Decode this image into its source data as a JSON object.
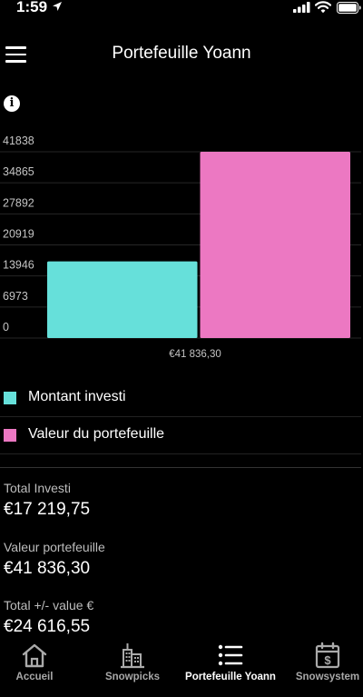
{
  "status_bar": {
    "time": "1:59"
  },
  "header": {
    "title": "Portefeuille Yoann"
  },
  "chart_data": {
    "type": "bar",
    "title": "",
    "xlabel": "",
    "ylabel": "",
    "categories": [
      "€41 836,30"
    ],
    "series": [
      {
        "name": "Montant investi",
        "values": [
          17219.75
        ],
        "color": "#66e0da"
      },
      {
        "name": "Valeur du portefeuille",
        "values": [
          41836.3
        ],
        "color": "#ec78c2"
      }
    ],
    "y_ticks": [
      "41838",
      "34865",
      "27892",
      "20919",
      "13946",
      "6973",
      "0"
    ],
    "ylim": [
      0,
      41838
    ],
    "grid": true,
    "legend": "bottom"
  },
  "legend": [
    {
      "label": "Montant investi",
      "color": "#66e0da"
    },
    {
      "label": "Valeur du portefeuille",
      "color": "#ec78c2"
    }
  ],
  "stats": [
    {
      "label": "Total Investi",
      "value": "€17 219,75"
    },
    {
      "label": "Valeur portefeuille",
      "value": "€41 836,30"
    },
    {
      "label": "Total +/- value €",
      "value": "€24 616,55"
    }
  ],
  "tabs": [
    {
      "label": "Accueil",
      "icon": "home-icon"
    },
    {
      "label": "Snowpicks",
      "icon": "buildings-icon"
    },
    {
      "label": "Portefeuille Yoann",
      "icon": "list-icon",
      "active": true
    },
    {
      "label": "Snowsystem",
      "icon": "calendar-dollar-icon"
    }
  ]
}
